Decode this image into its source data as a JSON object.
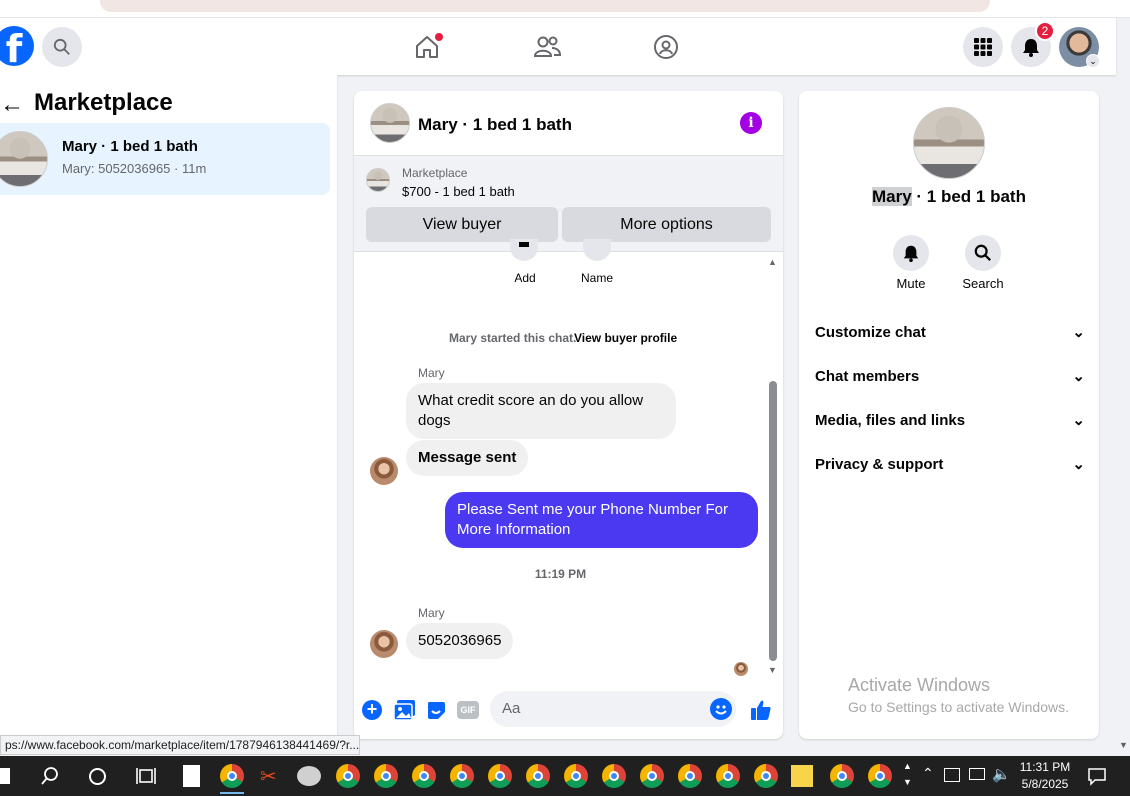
{
  "browser": {
    "status_url": "ps://www.facebook.com/marketplace/item/1787946138441469/?r..."
  },
  "topnav": {
    "notification_count": "2"
  },
  "left": {
    "back_label": "←",
    "title": "Marketplace",
    "conversation": {
      "title": "Mary · 1 bed 1 bath",
      "preview": "Mary: 5052036965 · 11m"
    }
  },
  "chat": {
    "header_title": "Mary · 1 bed 1 bath",
    "listing": {
      "source": "Marketplace",
      "summary": "$700 - 1 bed 1 bath"
    },
    "view_buyer": "View buyer",
    "more_options": "More options",
    "quick_actions": [
      {
        "label": "Add"
      },
      {
        "label": "Name"
      }
    ],
    "started_text": "Mary started this chat.",
    "view_buyer_profile": "View buyer profile",
    "sender1": "Mary",
    "msg1": "What credit score an do you allow dogs",
    "msg2": "Message sent",
    "msg3": "Please Sent me your Phone Number For More Information",
    "timestamp": "11:19 PM",
    "sender2": "Mary",
    "msg4": "5052036965",
    "composer_placeholder": "Aa",
    "gif_label": "GIF"
  },
  "right": {
    "name_highlight": "Mary",
    "name_rest": " · 1 bed 1 bath",
    "mute_label": "Mute",
    "search_label": "Search",
    "sections": [
      "Customize chat",
      "Chat members",
      "Media, files and links",
      "Privacy & support"
    ],
    "watermark_title": "Activate Windows",
    "watermark_sub": "Go to Settings to activate Windows."
  },
  "taskbar": {
    "time": "11:31 PM",
    "date": "5/8/2025"
  },
  "colors": {
    "brand": "#0866ff",
    "outgoing_bubble": "#4a39f0",
    "info_icon": "#a400e6",
    "notification_red": "#e41e3f"
  }
}
